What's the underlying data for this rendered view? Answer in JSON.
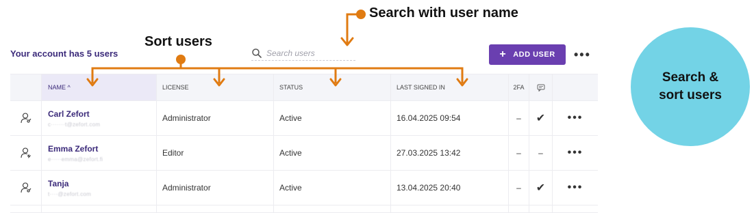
{
  "account": {
    "summary": "Your account has 5 users"
  },
  "search": {
    "placeholder": "Search users"
  },
  "toolbar": {
    "add_user_label": "ADD USER",
    "more_label": "•••"
  },
  "table": {
    "columns": [
      "NAME ^",
      "LICENSE",
      "STATUS",
      "LAST SIGNED IN",
      "2FA"
    ],
    "rows": [
      {
        "name": "Carl Zefort",
        "email": "c·······t@zefort.com",
        "license": "Administrator",
        "status": "Active",
        "last_signed_in": "16.04.2025 09:54",
        "twofa": "–",
        "sso": "✔",
        "actions": "•••"
      },
      {
        "name": "Emma Zefort",
        "email": "e·····emma@zefort.fi",
        "license": "Editor",
        "status": "Active",
        "last_signed_in": "27.03.2025 13:42",
        "twofa": "–",
        "sso": "–",
        "actions": "•••"
      },
      {
        "name": "Tanja",
        "email": "t····@zefort.com",
        "license": "Administrator",
        "status": "Active",
        "last_signed_in": "13.04.2025 20:40",
        "twofa": "–",
        "sso": "✔",
        "actions": "•••"
      }
    ]
  },
  "annotations": {
    "search_label": "Search with user name",
    "sort_label": "Sort users",
    "circle_line1": "Search &",
    "circle_line2": "sort users"
  },
  "colors": {
    "accent": "#6a3fb0",
    "annotation_orange": "#e07b12",
    "circle": "#73d3e6",
    "name_text": "#3b2a7a"
  }
}
